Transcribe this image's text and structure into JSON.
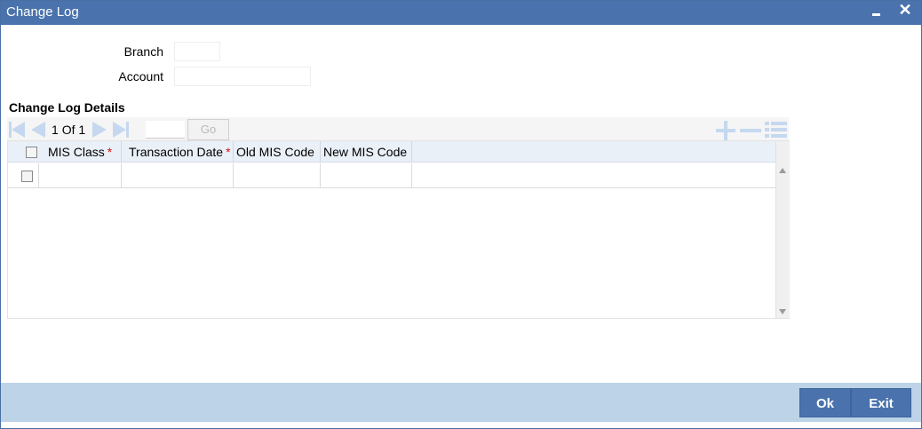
{
  "window": {
    "title": "Change Log",
    "close_glyph": "✕"
  },
  "form": {
    "branch_label": "Branch",
    "branch_value": "",
    "account_label": "Account",
    "account_value": ""
  },
  "section": {
    "title": "Change Log Details"
  },
  "pager": {
    "current": "1",
    "of_label": "Of",
    "total": "1",
    "page_input_value": "",
    "go_label": "Go"
  },
  "grid": {
    "columns": [
      {
        "label": "MIS Class",
        "required": true
      },
      {
        "label": "Transaction Date",
        "required": true
      },
      {
        "label": "Old MIS Code",
        "required": false
      },
      {
        "label": "New MIS Code",
        "required": false
      }
    ],
    "required_marker": "*",
    "rows": [
      {
        "mis_class": "",
        "transaction_date": "",
        "old_mis_code": "",
        "new_mis_code": ""
      }
    ]
  },
  "footer": {
    "ok_label": "Ok",
    "exit_label": "Exit"
  },
  "colors": {
    "titlebar": "#4a73ad",
    "footer": "#bcd3e8",
    "button": "#4a73ad",
    "required": "#dd1111",
    "pager_icon": "#c5d8ef"
  },
  "icons": {
    "first_page": "first-page-icon",
    "prev_page": "prev-page-icon",
    "next_page": "next-page-icon",
    "last_page": "last-page-icon",
    "add_row": "add-row-icon",
    "delete_row": "delete-row-icon",
    "single_view": "single-record-view-icon",
    "minimize": "minimize-icon",
    "close": "close-icon"
  }
}
